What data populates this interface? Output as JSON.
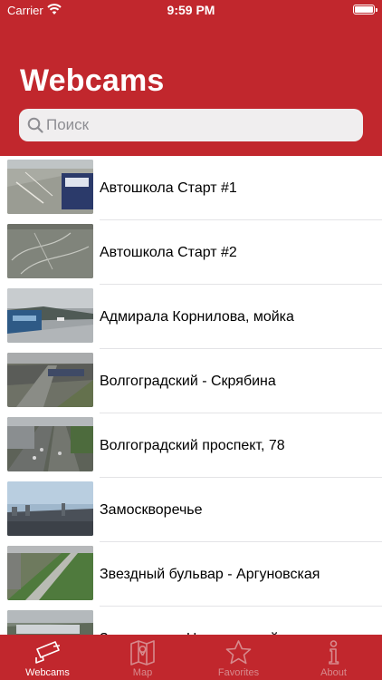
{
  "status_bar": {
    "carrier": "Carrier",
    "time": "9:59 PM"
  },
  "header": {
    "title": "Webcams"
  },
  "search": {
    "placeholder": "Поиск",
    "value": ""
  },
  "webcams": [
    {
      "name": "Автошкола Старт #1"
    },
    {
      "name": "Автошкола Старт #2"
    },
    {
      "name": "Адмирала Корнилова, мойка"
    },
    {
      "name": "Волгоградский - Скрябина"
    },
    {
      "name": "Волгоградский проспект, 78"
    },
    {
      "name": "Замоскворечье"
    },
    {
      "name": "Звездный бульвар - Аргуновская"
    },
    {
      "name": "Зеленоград, Центральный"
    }
  ],
  "tabs": [
    {
      "label": "Webcams",
      "icon": "camera-icon",
      "active": true
    },
    {
      "label": "Map",
      "icon": "map-icon",
      "active": false
    },
    {
      "label": "Favorites",
      "icon": "star-icon",
      "active": false
    },
    {
      "label": "About",
      "icon": "info-icon",
      "active": false
    }
  ],
  "colors": {
    "brand": "#c1272d",
    "tab_inactive": "#d78a8d"
  }
}
